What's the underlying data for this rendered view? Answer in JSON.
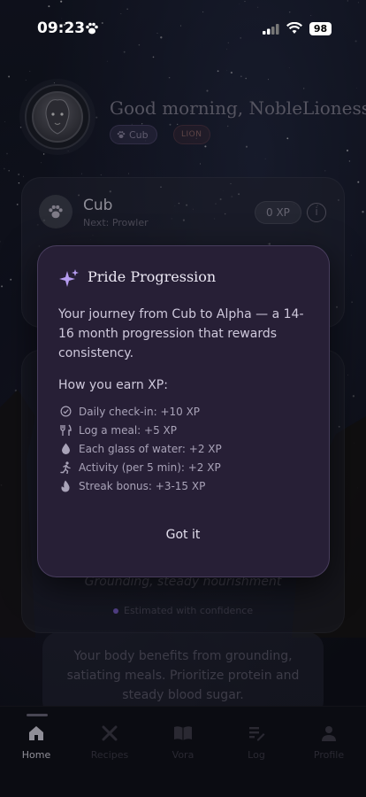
{
  "status_bar": {
    "time": "09:23",
    "battery": "98"
  },
  "header": {
    "greeting": "Good morning, NobleLioness",
    "rank_badge": "Cub",
    "species_badge": "LION"
  },
  "level_card": {
    "title": "Cub",
    "next": "Next: Prowler",
    "xp": "0 XP",
    "info_icon": "info-icon"
  },
  "nourishment": {
    "subtitle": "Grounding, steady nourishment",
    "confidence": "Estimated with confidence",
    "advice": "Your body benefits from grounding, satiating meals. Prioritize protein and steady blood sugar."
  },
  "modal": {
    "title": "Pride Progression",
    "description": "Your journey from Cub to Alpha — a 14-16 month progression that rewards consistency.",
    "earn_heading": "How you earn XP:",
    "items": [
      {
        "icon": "check-circle-icon",
        "label": "Daily check-in: +10 XP"
      },
      {
        "icon": "fork-knife-icon",
        "label": "Log a meal: +5 XP"
      },
      {
        "icon": "water-drop-icon",
        "label": "Each glass of water: +2 XP"
      },
      {
        "icon": "runner-icon",
        "label": "Activity (per 5 min): +2 XP"
      },
      {
        "icon": "flame-icon",
        "label": "Streak bonus: +3-15 XP"
      }
    ],
    "button": "Got it"
  },
  "tabs": [
    {
      "label": "Home",
      "icon": "home-icon",
      "active": true
    },
    {
      "label": "Recipes",
      "icon": "utensils-icon",
      "active": false
    },
    {
      "label": "Vora",
      "icon": "book-icon",
      "active": false
    },
    {
      "label": "Log",
      "icon": "edit-list-icon",
      "active": false
    },
    {
      "label": "Profile",
      "icon": "person-icon",
      "active": false
    }
  ],
  "colors": {
    "modal_bg": "#271f36",
    "accent": "#b69cf0",
    "background": "#0c0e16"
  }
}
